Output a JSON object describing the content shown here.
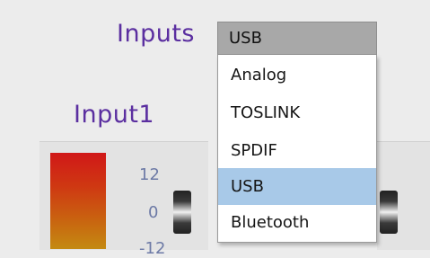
{
  "inputs_selector": {
    "label": "Inputs",
    "selected_value": "USB",
    "options": [
      {
        "label": "Analog"
      },
      {
        "label": "TOSLINK"
      },
      {
        "label": "SPDIF"
      },
      {
        "label": "USB",
        "selected": true
      },
      {
        "label": "Bluetooth"
      }
    ]
  },
  "channel": {
    "title": "Input1",
    "scale_ticks": [
      "12",
      "0",
      "-12"
    ]
  },
  "colors": {
    "label_text": "#5b2fa0",
    "scale_text": "#6d7aa6",
    "meter_top": "#d01818",
    "meter_bottom": "#c48a12",
    "selected_option": "#a8c9e8",
    "select_box": "#a8a8a8"
  }
}
